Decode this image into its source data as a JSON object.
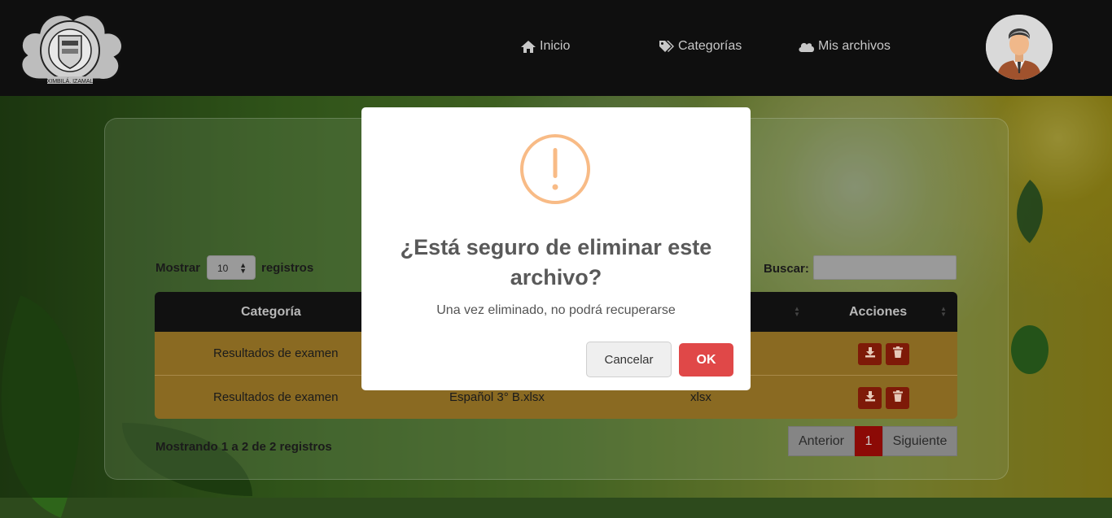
{
  "nav": {
    "home": "Inicio",
    "categories": "Categorías",
    "files": "Mis archivos"
  },
  "table_controls": {
    "show_prefix": "Mostrar",
    "page_size": "10",
    "show_suffix": "registros",
    "search_label": "Buscar:",
    "search_value": ""
  },
  "table": {
    "headers": [
      "Categoría",
      "Acciones"
    ],
    "rows": [
      {
        "category": "Resultados de examen",
        "file": "",
        "type": ""
      },
      {
        "category": "Resultados de examen",
        "file": "Español 3° B.xlsx",
        "type": "xlsx"
      }
    ]
  },
  "footer": {
    "info": "Mostrando 1 a 2 de 2 registros",
    "prev": "Anterior",
    "page": "1",
    "next": "Siguiente"
  },
  "modal": {
    "title": "¿Está seguro de eliminar este archivo?",
    "text": "Una vez eliminado, no podrá recuperarse",
    "cancel": "Cancelar",
    "ok": "OK"
  },
  "colors": {
    "navbar": "#0f0f0f",
    "row": "#8a6a22",
    "danger": "#e04848",
    "warning": "#f8bb86"
  }
}
